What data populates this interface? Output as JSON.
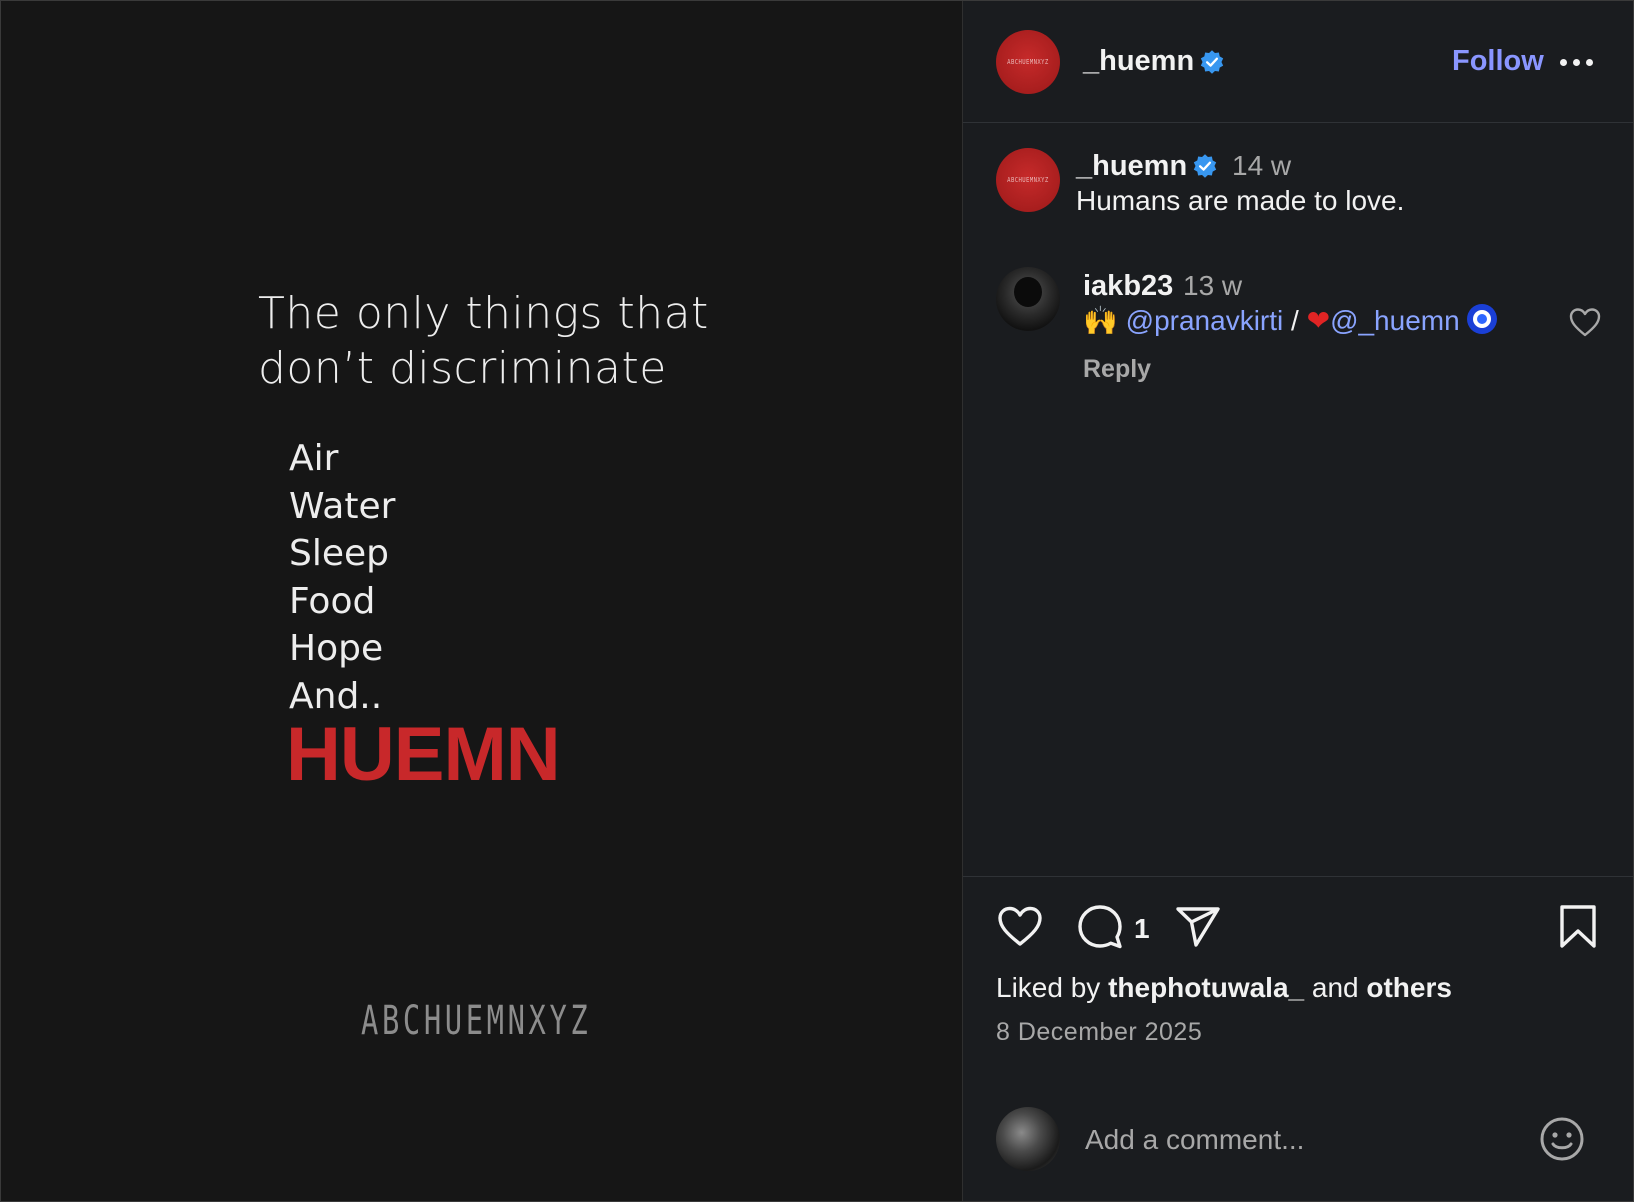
{
  "post_image": {
    "headline_lines": [
      "The only things that",
      "don’t discriminate"
    ],
    "list_items": [
      "Air",
      "Water",
      "Sleep",
      "Food",
      "Hope",
      "And.."
    ],
    "brand": "HUEMN",
    "tagline": "ABCHUEMNXYZ",
    "brand_color": "#c8282a"
  },
  "header": {
    "avatar_text": "ABCHUEMNXYZ",
    "username": "_huemn",
    "verified_icon": "verified-badge-icon",
    "follow_label": "Follow",
    "more_icon": "more-options-icon"
  },
  "caption": {
    "avatar_text": "ABCHUEMNXYZ",
    "username": "_huemn",
    "time": "14 w",
    "text": "Humans are made to love."
  },
  "comments": [
    {
      "username": "iakb23",
      "time": "13 w",
      "emoji_hands": "🙌",
      "mention_1": "@pranavkirti",
      "separator": "/",
      "emoji_heart": "❤",
      "mention_2": "@_huemn",
      "reply_label": "Reply"
    }
  ],
  "actions": {
    "comment_count": "1",
    "liked_by_prefix": "Liked by",
    "liked_by_user": "thephotuwala_",
    "liked_by_and": "and",
    "liked_by_others": "others",
    "date": "8 December 2025"
  },
  "add_comment": {
    "placeholder": "Add a comment..."
  },
  "colors": {
    "follow": "#8a96ff",
    "mention": "#8aa4ff",
    "verified": "#3897f0",
    "panel_bg": "#1a1c1f",
    "media_bg": "#161616"
  }
}
